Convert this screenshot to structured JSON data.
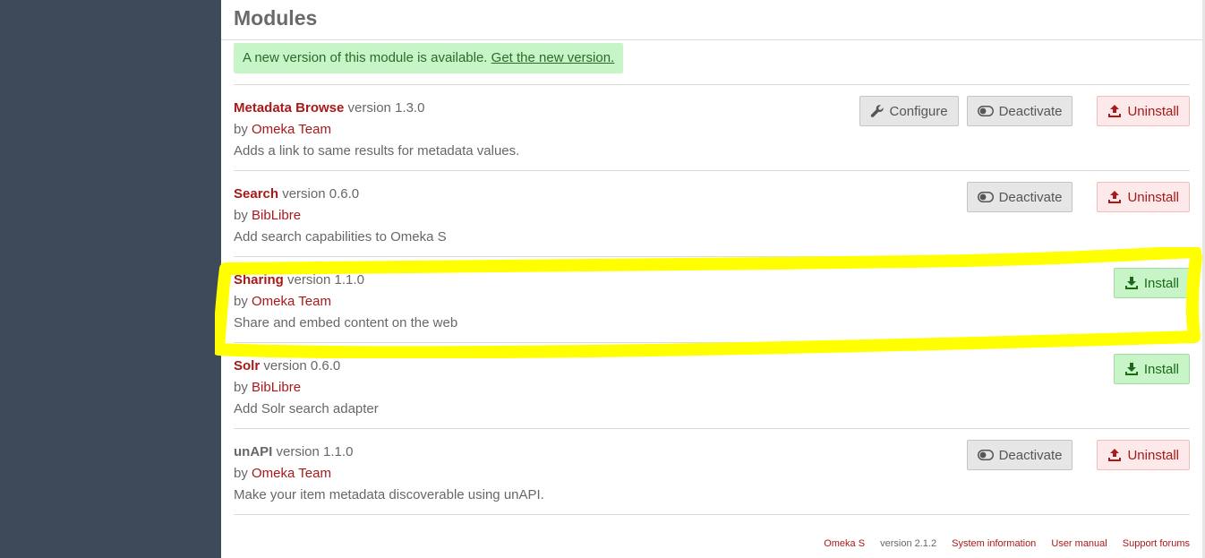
{
  "page": {
    "title": "Modules"
  },
  "notice": {
    "text": "A new version of this module is available.",
    "link": "Get the new version."
  },
  "labels": {
    "version_word": "version",
    "by_word": "by",
    "configure": "Configure",
    "deactivate": "Deactivate",
    "uninstall": "Uninstall",
    "install": "Install"
  },
  "modules": [
    {
      "name": "Metadata Browse",
      "version": "1.3.0",
      "author": "Omeka Team",
      "description": "Adds a link to same results for metadata values."
    },
    {
      "name": "Search",
      "version": "0.6.0",
      "author": "BibLibre",
      "description": "Add search capabilities to Omeka S"
    },
    {
      "name": "Sharing",
      "version": "1.1.0",
      "author": "Omeka Team",
      "description": "Share and embed content on the web"
    },
    {
      "name": "Solr",
      "version": "0.6.0",
      "author": "BibLibre",
      "description": "Add Solr search adapter"
    },
    {
      "name": "unAPI",
      "version": "1.1.0",
      "author": "Omeka Team",
      "description": "Make your item metadata discoverable using unAPI."
    }
  ],
  "footer": {
    "brand": "Omeka S",
    "version": "version 2.1.2",
    "system_info": "System information",
    "user_manual": "User manual",
    "support_forums": "Support forums"
  },
  "colors": {
    "sidebar": "#3d4a5a",
    "link_red": "#a91919",
    "success_bg": "#c8f5c8",
    "highlight": "#ffff00"
  },
  "icons": {
    "configure": "wrench-icon",
    "deactivate": "toggle-icon",
    "uninstall": "upload-icon",
    "install": "download-icon"
  }
}
